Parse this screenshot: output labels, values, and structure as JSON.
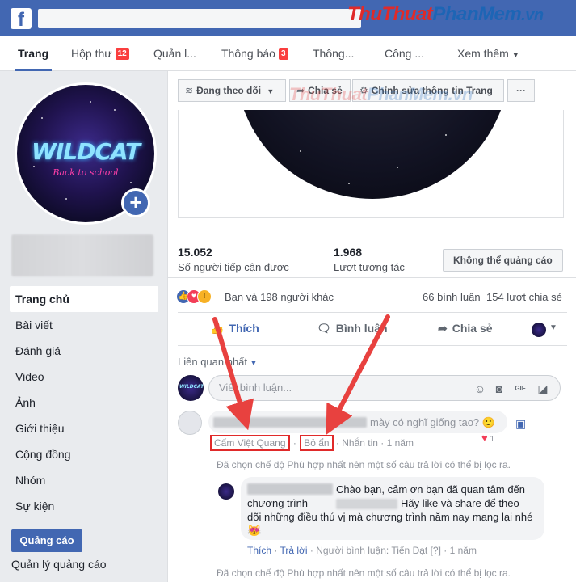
{
  "watermark": {
    "part1": "ThuThuat",
    "part2": "PhanMem",
    "part3": ".vn"
  },
  "tabs": [
    {
      "label": "Trang",
      "active": true
    },
    {
      "label": "Hộp thư",
      "badge": "12"
    },
    {
      "label": "Quản l..."
    },
    {
      "label": "Thông báo",
      "badge": "3"
    },
    {
      "label": "Thông..."
    },
    {
      "label": "Công ..."
    },
    {
      "label": "Xem thêm"
    }
  ],
  "profile": {
    "logo_line1": "WILDCAT",
    "logo_line2": "Back to school"
  },
  "leftnav": [
    {
      "label": "Trang chủ",
      "active": true
    },
    {
      "label": "Bài viết"
    },
    {
      "label": "Đánh giá"
    },
    {
      "label": "Video"
    },
    {
      "label": "Ảnh"
    },
    {
      "label": "Giới thiệu"
    },
    {
      "label": "Cộng đồng"
    },
    {
      "label": "Nhóm"
    },
    {
      "label": "Sự kiện"
    }
  ],
  "ads": {
    "button": "Quảng cáo",
    "manage": "Quản lý quảng cáo"
  },
  "actionbar": {
    "following": "Đang theo dõi",
    "share": "Chia sẻ",
    "edit": "Chỉnh sửa thông tin Trang",
    "more": "···"
  },
  "stats": {
    "reach_value": "15.052",
    "reach_label": "Số người tiếp cận được",
    "engage_value": "1.968",
    "engage_label": "Lượt tương tác",
    "no_ads": "Không thể quảng cáo"
  },
  "reactions": {
    "text": "Bạn và 198 người khác",
    "comments": "66 bình luận",
    "shares": "154 lượt chia sẻ"
  },
  "post_actions": {
    "like": "Thích",
    "comment": "Bình luận",
    "share": "Chia sẻ"
  },
  "sort": {
    "label": "Liên quan nhất"
  },
  "comment_input": {
    "placeholder": "Viết bình luận..."
  },
  "comment1": {
    "text": "mày có nghĩ giống tao? 🙂",
    "ban": "Cấm Việt Quang",
    "hide": "Bỏ ẩn",
    "message": "Nhắn tin",
    "time": "1 năm",
    "reaction_count": "1"
  },
  "notice": "Đã chọn chế độ Phù hợp nhất nên một số câu trả lời có thể bị lọc ra.",
  "reply": {
    "line1": "Chào bạn, cảm ơn bạn đã quan tâm đến",
    "line2a": "chương trình",
    "line2b": "Hãy like và share để theo",
    "line3": "dõi những điều thú vị mà chương trình năm nay mang lại nhé",
    "emoji": "😻",
    "like": "Thích",
    "reply": "Trả lời",
    "author": "Người bình luận: Tiến Đạt",
    "help": "[?]",
    "time": "1 năm"
  },
  "colors": {
    "facebook_blue": "#4267b2",
    "highlight_red": "#e02a2a",
    "badge_red": "#fa3e3e"
  },
  "icons": [
    "facebook-logo-icon",
    "plus-icon",
    "rss-icon",
    "share-arrow-icon",
    "gear-icon",
    "thumbs-up-icon",
    "comment-icon",
    "emoji-icon",
    "camera-icon",
    "gif-icon",
    "sticker-icon",
    "heart-icon",
    "edit-icon"
  ]
}
